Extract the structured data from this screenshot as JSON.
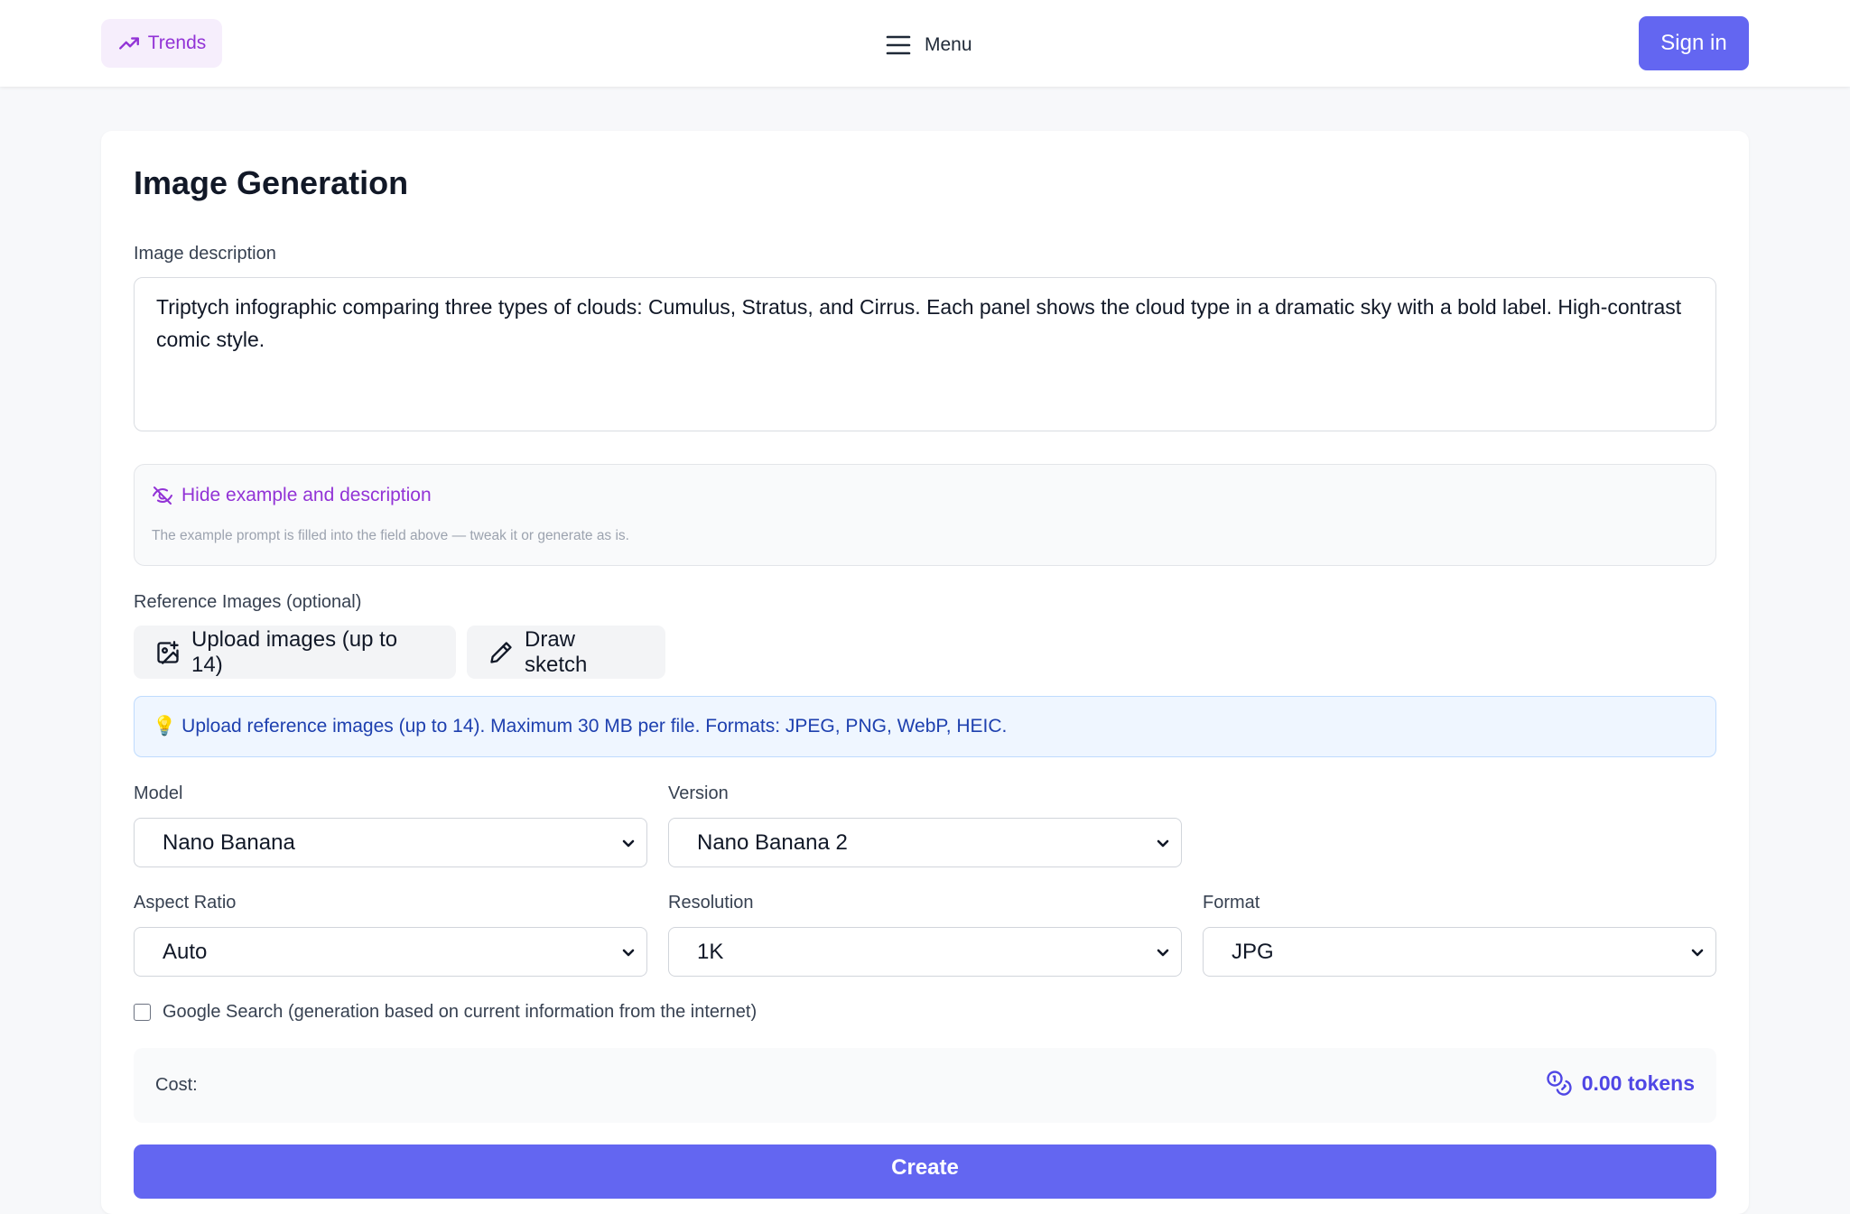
{
  "header": {
    "trends_label": "Trends",
    "menu_label": "Menu",
    "signin_label": "Sign in"
  },
  "main": {
    "title": "Image Generation",
    "description_label": "Image description",
    "description_value": "Triptych infographic comparing three types of clouds: Cumulus, Stratus, and Cirrus. Each panel shows the cloud type in a dramatic sky with a bold label. High-contrast comic style.",
    "example": {
      "toggle_label": "Hide example and description",
      "note": "The example prompt is filled into the field above — tweak it or generate as is."
    },
    "reference": {
      "label": "Reference Images (optional)",
      "upload_label": "Upload images (up to 14)",
      "sketch_label": "Draw sketch",
      "info_icon": "💡",
      "info_text": "Upload reference images (up to 14). Maximum 30 MB per file. Formats: JPEG, PNG, WebP, HEIC."
    },
    "settings": {
      "model_label": "Model",
      "model_value": "Nano Banana",
      "version_label": "Version",
      "version_value": "Nano Banana 2",
      "aspect_label": "Aspect Ratio",
      "aspect_value": "Auto",
      "resolution_label": "Resolution",
      "resolution_value": "1K",
      "format_label": "Format",
      "format_value": "JPG"
    },
    "google_search_label": "Google Search (generation based on current information from the internet)",
    "cost": {
      "label": "Cost:",
      "value": "0.00 tokens"
    },
    "create_label": "Create"
  },
  "colors": {
    "accent": "#6366f1",
    "purple_link": "#9233d6",
    "info_text": "#1e40af"
  },
  "icons": [
    "trending-up-icon",
    "hamburger-menu-icon",
    "eye-off-icon",
    "image-plus-icon",
    "pencil-icon",
    "lightbulb-icon",
    "chevron-down-icon",
    "coins-icon"
  ]
}
